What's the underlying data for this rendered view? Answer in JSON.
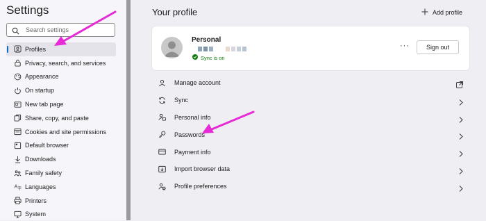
{
  "sidebar": {
    "title": "Settings",
    "search_placeholder": "Search settings",
    "items": [
      {
        "label": "Profiles",
        "icon": "profile-icon",
        "active": true
      },
      {
        "label": "Privacy, search, and services",
        "icon": "lock-icon"
      },
      {
        "label": "Appearance",
        "icon": "appearance-icon"
      },
      {
        "label": "On startup",
        "icon": "power-icon"
      },
      {
        "label": "New tab page",
        "icon": "new-tab-icon"
      },
      {
        "label": "Share, copy, and paste",
        "icon": "share-icon"
      },
      {
        "label": "Cookies and site permissions",
        "icon": "cookies-icon"
      },
      {
        "label": "Default browser",
        "icon": "browser-icon"
      },
      {
        "label": "Downloads",
        "icon": "download-icon"
      },
      {
        "label": "Family safety",
        "icon": "family-icon"
      },
      {
        "label": "Languages",
        "icon": "language-icon"
      },
      {
        "label": "Printers",
        "icon": "printer-icon"
      },
      {
        "label": "System",
        "icon": "system-icon"
      }
    ]
  },
  "main": {
    "title": "Your profile",
    "add_profile": "Add profile",
    "profile": {
      "name": "Personal",
      "sync_status": "Sync is on",
      "more": "···",
      "sign_out": "Sign out"
    },
    "options": [
      {
        "label": "Manage account",
        "icon": "person-icon",
        "trailing": "external-link-icon"
      },
      {
        "label": "Sync",
        "icon": "sync-icon",
        "trailing": "chevron-right-icon"
      },
      {
        "label": "Personal info",
        "icon": "personal-info-icon",
        "trailing": "chevron-right-icon"
      },
      {
        "label": "Passwords",
        "icon": "key-icon",
        "trailing": "chevron-right-icon"
      },
      {
        "label": "Payment info",
        "icon": "card-icon",
        "trailing": "chevron-right-icon"
      },
      {
        "label": "Import browser data",
        "icon": "import-icon",
        "trailing": "chevron-right-icon"
      },
      {
        "label": "Profile preferences",
        "icon": "profile-preferences-icon",
        "trailing": "chevron-right-icon"
      }
    ]
  },
  "colors": {
    "accent": "#0f6cbd",
    "sync_green": "#107c10",
    "annotation_arrow": "#e62bd6"
  }
}
